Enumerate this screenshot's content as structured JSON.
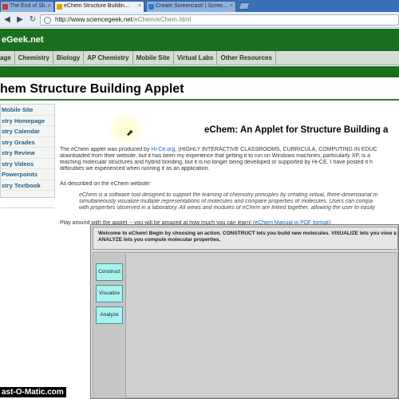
{
  "browser": {
    "tabs": [
      {
        "label": "The End of Sli...",
        "active": false,
        "close": "×",
        "favicon_color": "#c0392b"
      },
      {
        "label": "eChem Structure Buildin...",
        "active": true,
        "close": "×",
        "favicon_color": "#e5a300"
      },
      {
        "label": "Create Screencast! | Scree...",
        "active": false,
        "close": "×",
        "favicon_color": "#2a7bd4"
      }
    ],
    "nav": {
      "back_icon": "back-arrow-icon",
      "forward_icon": "forward-arrow-icon",
      "reload_icon": "reload-icon"
    },
    "url_host": "http://www.sciencegeek.net",
    "url_path": "/eChem/eChem.html"
  },
  "site": {
    "logo_text": "eGeek.net",
    "nav": [
      "age",
      "Chemistry",
      "Biology",
      "AP Chemistry",
      "Mobile Site",
      "Virtual Labs",
      "Other Resources"
    ]
  },
  "page": {
    "title": "hem Structure Building Applet",
    "sidebar": [
      "Mobile Site",
      "stry Homepage",
      "stry Calendar",
      "stry Grades",
      "stry Review",
      "stry Videos",
      "Powerpoints",
      "stry Textbook"
    ],
    "heading": "eChem: An Applet for Structure Building a",
    "intro_lines": [
      "The eChem applet was produced by",
      "Hi-Ce.org",
      ", (HIGHLY INTERACTIVE CLASSROOMS, CURRICULA, COMPUTING IN EDUC",
      "downloaded from their website, but it has been my experience that getting it to run on Windows machines, particularly XP, is a",
      "teaching molecular structures and hybrid bonding, but it is no longer being developed or supported by Hi-CE. I have posted it h",
      "difficulties we experienced when running it as an application."
    ],
    "described": "As described on the eChem website:",
    "quote_lines": [
      "eChem is a software tool designed to support the learning of chemistry principles by creating virtual, three-dimensional m",
      "simultaneously visualize multiple representations of molecules and compare properties of molecules. Users can compa",
      "with properties observed in a laboratory. All views and modules of eChem are linked together, allowing the user to easily"
    ],
    "play_text": "Play around with the applet -- you will be amazed at how much you can learn! (",
    "manual_link": "eChem Manual in PDF format",
    "play_close": ")"
  },
  "applet": {
    "message_line1": "Welcome to eChem! Begin by choosing an action. CONSTRUCT lets you build new molecules. VISUALIZE lets you view a",
    "message_line2": "ANALYZE lets you compute molecular properties.",
    "buttons": [
      "Construct",
      "Visualize",
      "Analyze"
    ],
    "button_color": "#a9f2f0"
  },
  "watermark": "ast-O-Matic.com",
  "colors": {
    "site_green": "#1b6e1e",
    "link_blue": "#1a5fb4",
    "tab_blue": "#3b6fb6"
  }
}
